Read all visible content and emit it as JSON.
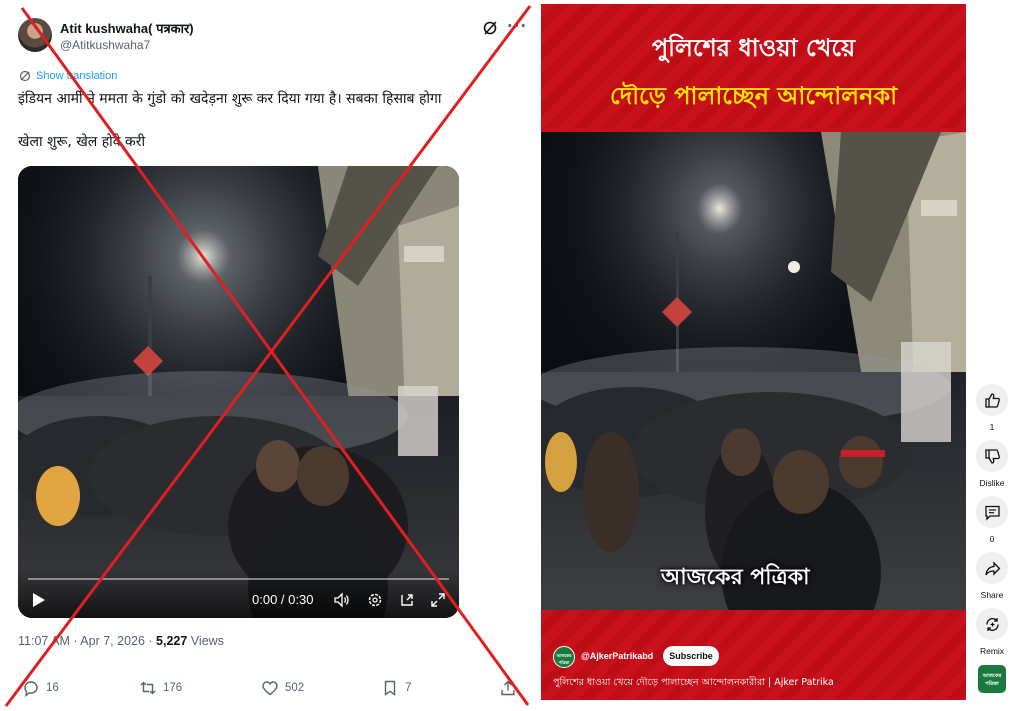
{
  "tweet": {
    "author_name": "Atit kushwaha( पत्रकार)",
    "author_handle": "@Atitkushwaha7",
    "translate_label": "Show translation",
    "text_line1": "इंडियन आर्मी ने ममता के गुंडो को खदेड़ना शुरू कर दिया गया है। सबका हिसाब होगा",
    "text_line2": "खेला शुरू,     खेल होवे करी",
    "video": {
      "time": "0:00 / 0:30",
      "progress_fraction": 0.0
    },
    "timestamp": "11:07 AM · Apr 7, 2026 · ",
    "views_count": "5,227",
    "views_label": " Views",
    "replies": "16",
    "reposts": "176",
    "likes": "502",
    "bookmarks": "7",
    "icons": [
      "grok-icon",
      "more-icon",
      "translate-icon",
      "play-icon",
      "volume-icon",
      "settings-icon",
      "pip-icon",
      "fullscreen-icon",
      "reply-icon",
      "repost-icon",
      "like-icon",
      "bookmark-icon",
      "share-icon"
    ]
  },
  "short": {
    "headline_line1": "পুলিশের ধাওয়া খেয়ে",
    "headline_line2": "দৌড়ে পালাচ্ছেন আন্দোলনকা",
    "watermark": "আজকের পত্রিকা",
    "channel_handle": "@AjkerPatrikabd",
    "subscribe_label": "Subscribe",
    "caption": "পুলিশের ধাওয়া খেয়ে দৌড়ে পালাচ্ছেন আন্দোলনকারীরা | Ajker Patrika",
    "channel_avatar_text": "আজকের পত্রিকা"
  },
  "rail": {
    "like_count": "1",
    "dislike_label": "Dislike",
    "comment_count": "0",
    "share_label": "Share",
    "remix_label": "Remix"
  },
  "colors": {
    "x_mark": "#e02020",
    "headline_bg": "#c8101a",
    "headline_highlight": "#ffe400",
    "link_blue": "#1d9bf0"
  }
}
